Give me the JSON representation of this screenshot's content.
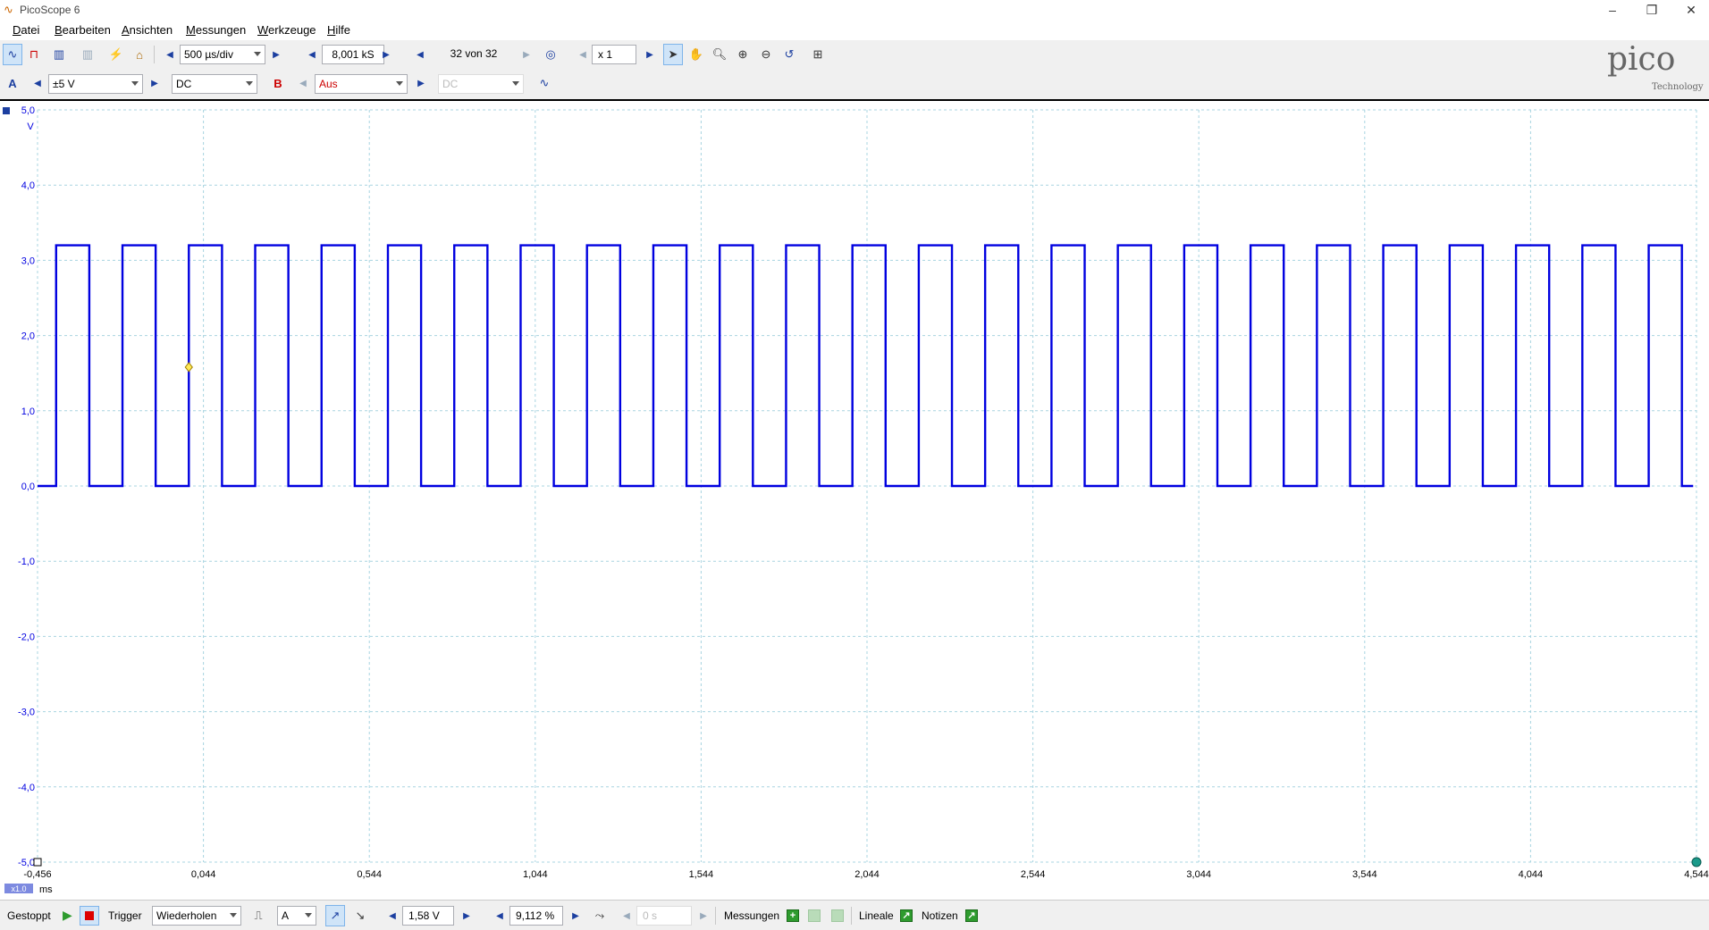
{
  "window": {
    "title": "PicoScope 6",
    "minimize": "–",
    "restore": "❐",
    "close": "✕"
  },
  "menu": [
    "Datei",
    "Bearbeiten",
    "Ansichten",
    "Messungen",
    "Werkzeuge",
    "Hilfe"
  ],
  "toolbar": {
    "timebase": "500 µs/div",
    "samples": "8,001 kS",
    "buffer": "32 von 32",
    "zoom": "x 1"
  },
  "channels": {
    "a": {
      "label": "A",
      "range": "±5 V",
      "coupling": "DC",
      "color": "#0000e0"
    },
    "b": {
      "label": "B",
      "range": "Aus",
      "coupling": "DC",
      "color": "#d00000"
    }
  },
  "logo": {
    "text": "pico",
    "sub": "Technology"
  },
  "plot": {
    "y_unit": "V",
    "x_unit": "ms",
    "x_scale_badge": "x1.0",
    "y_ticks": [
      "5,0",
      "4,0",
      "3,0",
      "2,0",
      "1,0",
      "0,0",
      "-1,0",
      "-2,0",
      "-3,0",
      "-4,0",
      "-5,0"
    ],
    "x_ticks": [
      "-0,456",
      "0,044",
      "0,544",
      "1,044",
      "1,544",
      "2,044",
      "2,544",
      "3,044",
      "3,544",
      "4,044",
      "4,544"
    ]
  },
  "chart_data": {
    "type": "line",
    "xlabel": "ms",
    "ylabel": "V",
    "xlim": [
      -0.456,
      4.544
    ],
    "ylim": [
      -5.0,
      5.0
    ],
    "grid": true,
    "series": [
      {
        "color": "#0000e0",
        "signal": "square wave",
        "high": 3.2,
        "low": 0.0,
        "period_ms": 0.2,
        "first_rising_edge_ms": -0.4,
        "high_duration_ms": 0.1
      }
    ],
    "trigger_marker": {
      "x": 0.0,
      "y": 1.58
    }
  },
  "status": {
    "state": "Gestoppt",
    "trigger_label": "Trigger",
    "trigger_mode": "Wiederholen",
    "trigger_channel": "A",
    "trigger_level": "1,58 V",
    "pretrigger": "9,112 %",
    "delay": "0 s",
    "measurements": "Messungen",
    "rulers": "Lineale",
    "notes": "Notizen"
  }
}
